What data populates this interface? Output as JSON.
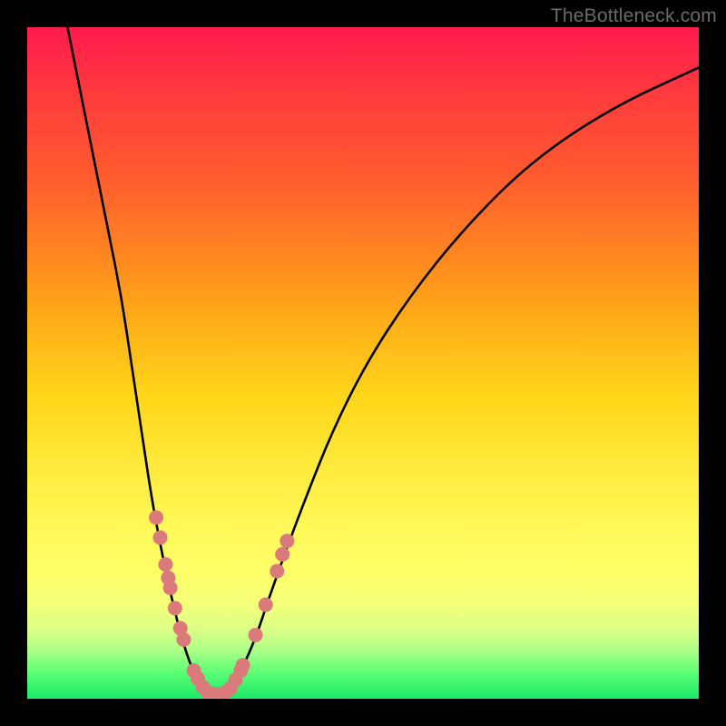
{
  "watermark": "TheBottleneck.com",
  "chart_data": {
    "type": "line",
    "title": "",
    "xlabel": "",
    "ylabel": "",
    "xlim": [
      0,
      100
    ],
    "ylim": [
      0,
      100
    ],
    "curve": [
      {
        "x": 6,
        "y": 100
      },
      {
        "x": 8,
        "y": 90
      },
      {
        "x": 10,
        "y": 80
      },
      {
        "x": 12,
        "y": 70
      },
      {
        "x": 14,
        "y": 60
      },
      {
        "x": 15.5,
        "y": 50
      },
      {
        "x": 17,
        "y": 40
      },
      {
        "x": 18.5,
        "y": 30
      },
      {
        "x": 20,
        "y": 22
      },
      {
        "x": 21.5,
        "y": 15
      },
      {
        "x": 23,
        "y": 9
      },
      {
        "x": 24.5,
        "y": 4.5
      },
      {
        "x": 26,
        "y": 1.8
      },
      {
        "x": 27.5,
        "y": 0.6
      },
      {
        "x": 29,
        "y": 0.6
      },
      {
        "x": 30.5,
        "y": 1.8
      },
      {
        "x": 32,
        "y": 4.5
      },
      {
        "x": 34,
        "y": 9
      },
      {
        "x": 36,
        "y": 15
      },
      {
        "x": 38.5,
        "y": 22
      },
      {
        "x": 41.5,
        "y": 30
      },
      {
        "x": 45.5,
        "y": 40
      },
      {
        "x": 50.5,
        "y": 50
      },
      {
        "x": 57,
        "y": 60
      },
      {
        "x": 65,
        "y": 70
      },
      {
        "x": 75,
        "y": 80
      },
      {
        "x": 87,
        "y": 88
      },
      {
        "x": 100,
        "y": 94
      }
    ],
    "markers_left": [
      {
        "x": 19.2,
        "y": 27
      },
      {
        "x": 19.8,
        "y": 24
      },
      {
        "x": 20.6,
        "y": 20
      },
      {
        "x": 21.0,
        "y": 18
      },
      {
        "x": 21.3,
        "y": 16.5
      },
      {
        "x": 22.0,
        "y": 13.5
      },
      {
        "x": 22.8,
        "y": 10.5
      },
      {
        "x": 23.3,
        "y": 8.8
      },
      {
        "x": 24.8,
        "y": 4.2
      },
      {
        "x": 25.4,
        "y": 3.0
      }
    ],
    "markers_bottom": [
      {
        "x": 26.2,
        "y": 1.7
      },
      {
        "x": 26.9,
        "y": 1.0
      },
      {
        "x": 27.8,
        "y": 0.7
      },
      {
        "x": 28.6,
        "y": 0.7
      },
      {
        "x": 29.4,
        "y": 0.9
      },
      {
        "x": 30.2,
        "y": 1.5
      }
    ],
    "markers_right": [
      {
        "x": 31.0,
        "y": 2.8
      },
      {
        "x": 31.8,
        "y": 4.2
      },
      {
        "x": 32.1,
        "y": 5.0
      },
      {
        "x": 34.0,
        "y": 9.5
      },
      {
        "x": 35.5,
        "y": 14
      },
      {
        "x": 37.2,
        "y": 19
      },
      {
        "x": 38.0,
        "y": 21.5
      },
      {
        "x": 38.7,
        "y": 23.5
      }
    ],
    "marker_style": {
      "fill": "#db7a7a",
      "radius_px": 8
    }
  }
}
